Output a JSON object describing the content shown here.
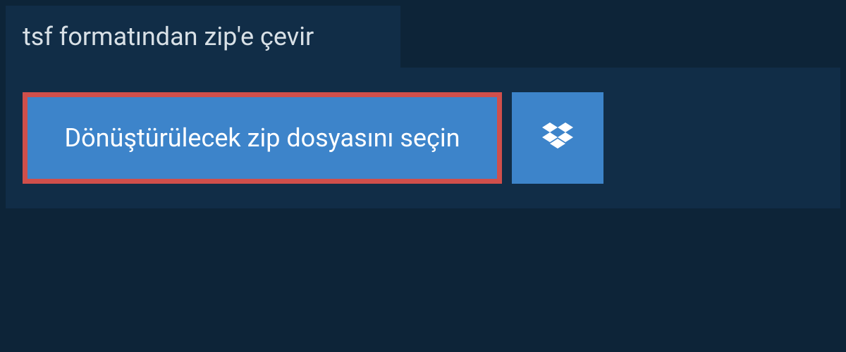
{
  "header": {
    "title": "tsf formatından zip'e çevir"
  },
  "upload": {
    "select_file_label": "Dönüştürülecek zip dosyasını seçin",
    "dropbox_icon_name": "dropbox-icon"
  },
  "colors": {
    "background": "#0d2438",
    "panel": "#112d47",
    "button": "#3d84ca",
    "highlight_border": "#d04f4b",
    "text_light": "#d8e0e6",
    "text_white": "#ffffff"
  }
}
